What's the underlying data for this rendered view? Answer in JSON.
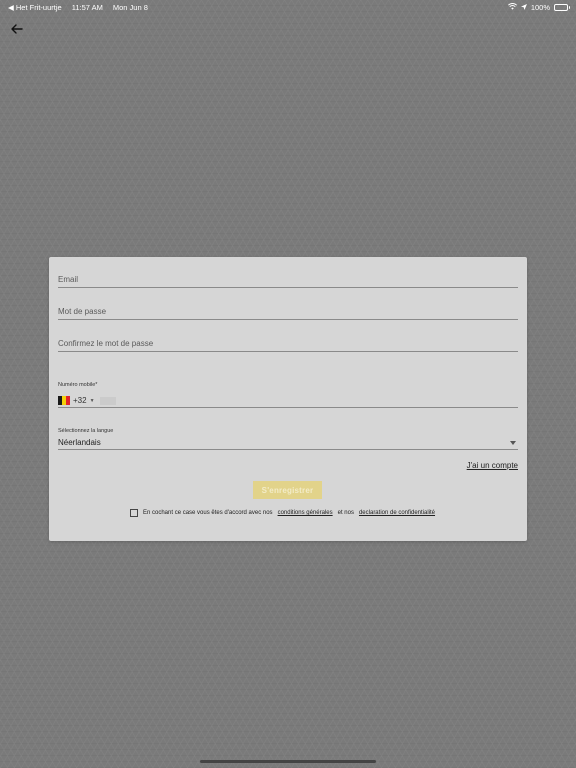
{
  "status_bar": {
    "carrier": "◀ Het Frit-uurtje",
    "time": "11:57 AM",
    "date": "Mon Jun 8",
    "battery": "100%"
  },
  "form": {
    "email_placeholder": "Email",
    "password_placeholder": "Mot de passe",
    "confirm_password_placeholder": "Confirmez le mot de passe",
    "phone_label": "Numéro mobile*",
    "phone_code": "+32",
    "language_label": "Sélectionnez la langue",
    "language_value": "Néerlandais",
    "have_account_link": "J'ai un compte",
    "register_button": "S'enregistrer",
    "consent_text_1": "En cochant ce case vous êtes d'accord avec nos",
    "consent_link_1": "conditions générales",
    "consent_text_2": "et nos",
    "consent_link_2": "declaration de confidentialité"
  },
  "colors": {
    "background": "#7a7a7a",
    "card": "#d6d6d6",
    "button_disabled": "#e2d38a",
    "flag_black": "#1a1a1a",
    "flag_yellow": "#f4d20a",
    "flag_red": "#e2242b"
  }
}
